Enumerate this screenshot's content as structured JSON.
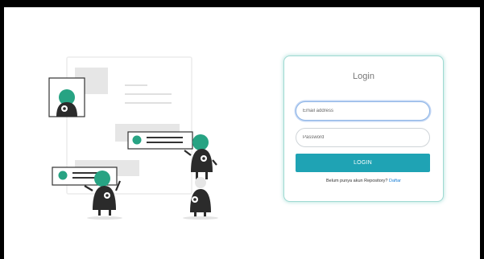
{
  "login": {
    "title": "Login",
    "email_placeholder": "Email address",
    "password_placeholder": "Password",
    "button_label": "LOGIN",
    "register_prompt": "Belum punya akun Repository?",
    "register_link": "Daftar"
  },
  "colors": {
    "accent": "#1fa3b4",
    "illustration_green": "#27a383",
    "link": "#1a7fd6",
    "card_border": "#9fd9d2"
  },
  "illustration": {
    "description_icon": "people-collaborating-illustration"
  }
}
